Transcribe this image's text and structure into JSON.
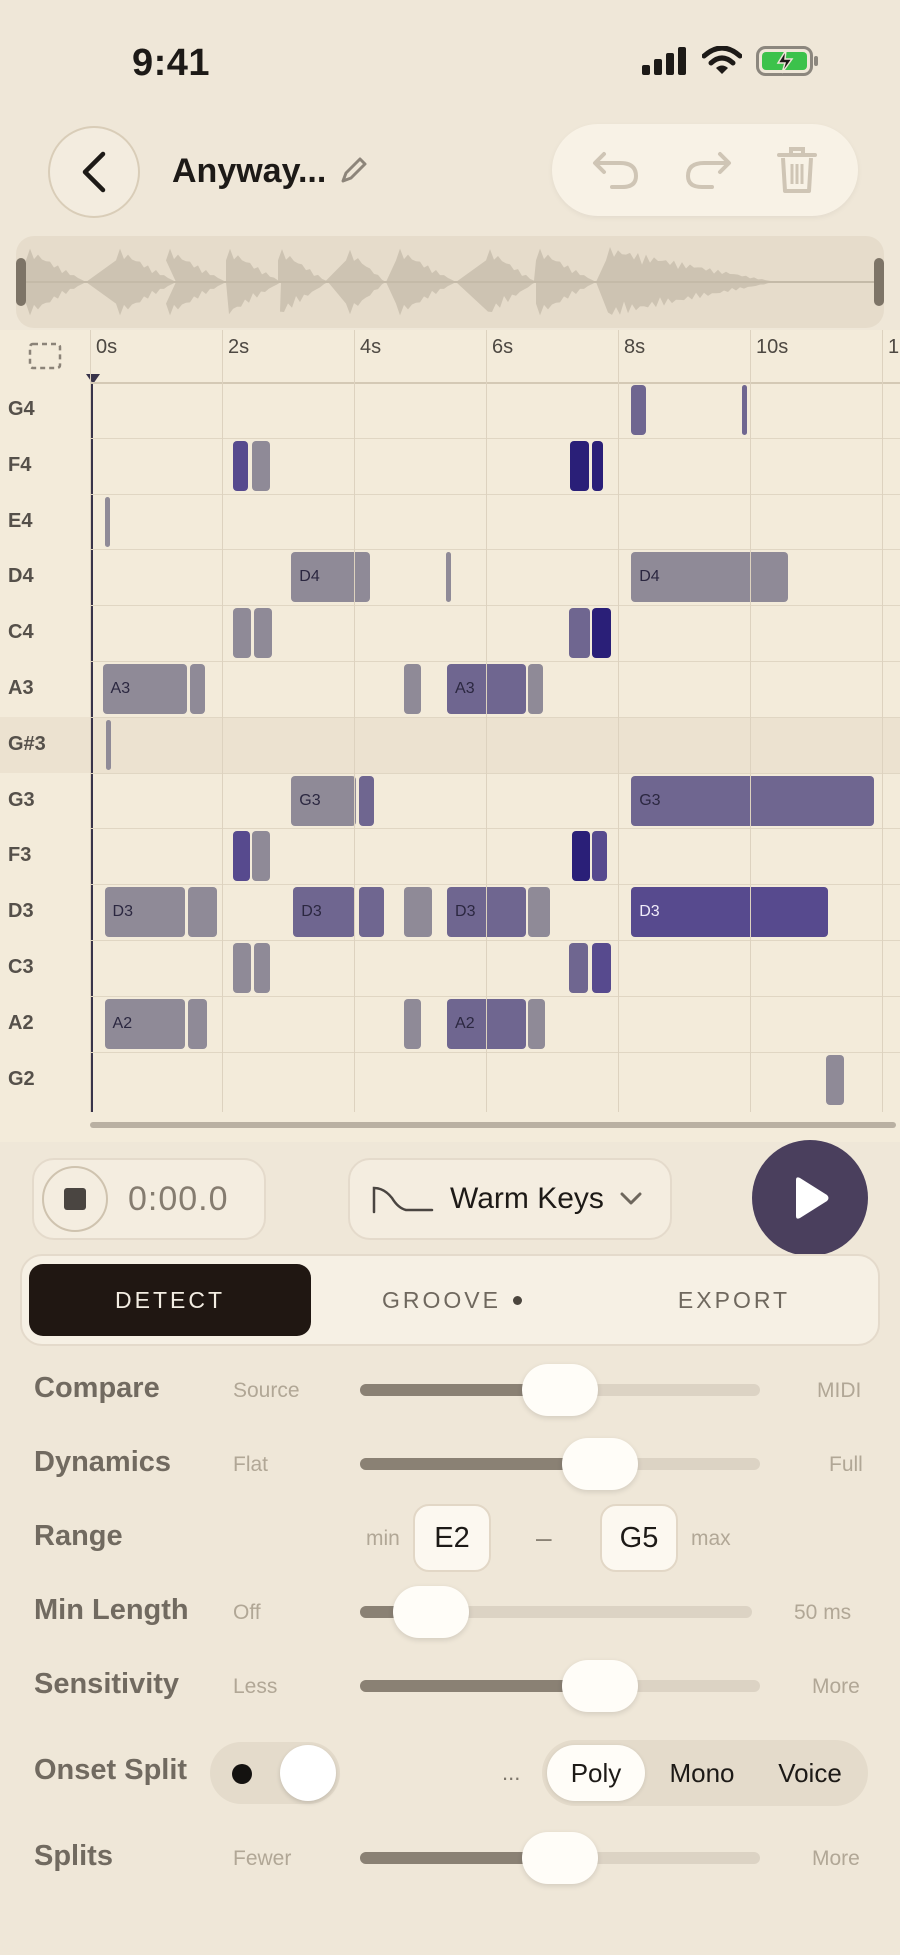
{
  "status_bar": {
    "time": "9:41"
  },
  "header": {
    "title": "Anyway..."
  },
  "timeline": {
    "time_labels": [
      "0s",
      "2s",
      "4s",
      "6s",
      "8s",
      "10s",
      "1"
    ],
    "keys": [
      "G4",
      "F4",
      "E4",
      "D4",
      "C4",
      "A3",
      "G#3",
      "G3",
      "F3",
      "D3",
      "C3",
      "A2",
      "G2"
    ],
    "highlighted_key": "G#3",
    "notes": [
      {
        "row": 0,
        "start": 8.2,
        "len": 0.22,
        "tone": 1,
        "label": ""
      },
      {
        "row": 0,
        "start": 9.88,
        "len": 0.07,
        "tone": 1,
        "label": ""
      },
      {
        "row": 1,
        "start": 2.16,
        "len": 0.24,
        "tone": 2,
        "label": ""
      },
      {
        "row": 1,
        "start": 2.45,
        "len": 0.27,
        "tone": 0,
        "label": ""
      },
      {
        "row": 1,
        "start": 7.28,
        "len": 0.28,
        "tone": 3,
        "label": ""
      },
      {
        "row": 1,
        "start": 7.6,
        "len": 0.17,
        "tone": 3,
        "label": ""
      },
      {
        "row": 2,
        "start": 0.22,
        "len": 0.07,
        "tone": 0,
        "label": ""
      },
      {
        "row": 3,
        "start": 3.05,
        "len": 1.2,
        "tone": 0,
        "label": "D4"
      },
      {
        "row": 3,
        "start": 5.39,
        "len": 0.05,
        "tone": 0,
        "label": ""
      },
      {
        "row": 3,
        "start": 8.2,
        "len": 2.38,
        "tone": 0,
        "label": "D4"
      },
      {
        "row": 4,
        "start": 2.16,
        "len": 0.28,
        "tone": 0,
        "label": ""
      },
      {
        "row": 4,
        "start": 2.48,
        "len": 0.28,
        "tone": 0,
        "label": ""
      },
      {
        "row": 4,
        "start": 7.26,
        "len": 0.31,
        "tone": 1,
        "label": ""
      },
      {
        "row": 4,
        "start": 7.6,
        "len": 0.3,
        "tone": 3,
        "label": ""
      },
      {
        "row": 5,
        "start": 0.19,
        "len": 1.28,
        "tone": 0,
        "label": "A3"
      },
      {
        "row": 5,
        "start": 1.52,
        "len": 0.22,
        "tone": 0,
        "label": ""
      },
      {
        "row": 5,
        "start": 4.75,
        "len": 0.26,
        "tone": 0,
        "label": ""
      },
      {
        "row": 5,
        "start": 5.41,
        "len": 1.2,
        "tone": 1,
        "label": "A3"
      },
      {
        "row": 5,
        "start": 6.64,
        "len": 0.22,
        "tone": 0,
        "label": ""
      },
      {
        "row": 6,
        "start": 0.24,
        "len": 0.05,
        "tone": 0,
        "label": ""
      },
      {
        "row": 7,
        "start": 3.05,
        "len": 0.98,
        "tone": 0,
        "label": "G3"
      },
      {
        "row": 7,
        "start": 4.07,
        "len": 0.23,
        "tone": 1,
        "label": ""
      },
      {
        "row": 7,
        "start": 8.2,
        "len": 3.68,
        "tone": 1,
        "label": "G3"
      },
      {
        "row": 8,
        "start": 2.16,
        "len": 0.26,
        "tone": 2,
        "label": ""
      },
      {
        "row": 8,
        "start": 2.45,
        "len": 0.27,
        "tone": 0,
        "label": ""
      },
      {
        "row": 8,
        "start": 7.3,
        "len": 0.28,
        "tone": 3,
        "label": ""
      },
      {
        "row": 8,
        "start": 7.6,
        "len": 0.24,
        "tone": 2,
        "label": ""
      },
      {
        "row": 9,
        "start": 0.22,
        "len": 1.22,
        "tone": 0,
        "label": "D3"
      },
      {
        "row": 9,
        "start": 1.48,
        "len": 0.45,
        "tone": 0,
        "label": ""
      },
      {
        "row": 9,
        "start": 3.08,
        "len": 0.94,
        "tone": 1,
        "label": "D3"
      },
      {
        "row": 9,
        "start": 4.07,
        "len": 0.38,
        "tone": 1,
        "label": ""
      },
      {
        "row": 9,
        "start": 4.75,
        "len": 0.43,
        "tone": 0,
        "label": ""
      },
      {
        "row": 9,
        "start": 5.41,
        "len": 1.2,
        "tone": 1,
        "label": "D3"
      },
      {
        "row": 9,
        "start": 6.64,
        "len": 0.33,
        "tone": 0,
        "label": ""
      },
      {
        "row": 9,
        "start": 8.2,
        "len": 2.98,
        "tone": 2,
        "label": "D3"
      },
      {
        "row": 10,
        "start": 2.16,
        "len": 0.28,
        "tone": 0,
        "label": ""
      },
      {
        "row": 10,
        "start": 2.48,
        "len": 0.25,
        "tone": 0,
        "label": ""
      },
      {
        "row": 10,
        "start": 7.26,
        "len": 0.29,
        "tone": 1,
        "label": ""
      },
      {
        "row": 10,
        "start": 7.6,
        "len": 0.3,
        "tone": 2,
        "label": ""
      },
      {
        "row": 11,
        "start": 0.22,
        "len": 1.22,
        "tone": 0,
        "label": "A2"
      },
      {
        "row": 11,
        "start": 1.48,
        "len": 0.3,
        "tone": 0,
        "label": ""
      },
      {
        "row": 11,
        "start": 4.75,
        "len": 0.26,
        "tone": 0,
        "label": ""
      },
      {
        "row": 11,
        "start": 5.41,
        "len": 1.2,
        "tone": 1,
        "label": "A2"
      },
      {
        "row": 11,
        "start": 6.64,
        "len": 0.26,
        "tone": 0,
        "label": ""
      },
      {
        "row": 12,
        "start": 11.15,
        "len": 0.28,
        "tone": 0,
        "label": ""
      }
    ]
  },
  "transport": {
    "time": "0:00.0",
    "preset": "Warm Keys"
  },
  "tabs": [
    {
      "label": "DETECT",
      "active": true
    },
    {
      "label": "GROOVE",
      "active": false,
      "dot": true
    },
    {
      "label": "EXPORT",
      "active": false
    }
  ],
  "settings": {
    "compare": {
      "label": "Compare",
      "left": "Source",
      "right": "MIDI",
      "value": 0.5
    },
    "dynamics": {
      "label": "Dynamics",
      "left": "Flat",
      "right": "Full",
      "value": 0.6
    },
    "range": {
      "label": "Range",
      "min_label": "min",
      "max_label": "max",
      "min": "E2",
      "dash": "–",
      "max": "G5"
    },
    "min_length": {
      "label": "Min Length",
      "left": "Off",
      "right": "50 ms",
      "value": 0.18
    },
    "sensitivity": {
      "label": "Sensitivity",
      "left": "Less",
      "right": "More",
      "value": 0.6
    },
    "onset_split": {
      "label": "Onset Split",
      "ellipsis": "...",
      "modes": [
        "Poly",
        "Mono",
        "Voice"
      ],
      "selected": "Poly",
      "enabled": true
    },
    "splits": {
      "label": "Splits",
      "left": "Fewer",
      "right": "More",
      "value": 0.5
    }
  }
}
